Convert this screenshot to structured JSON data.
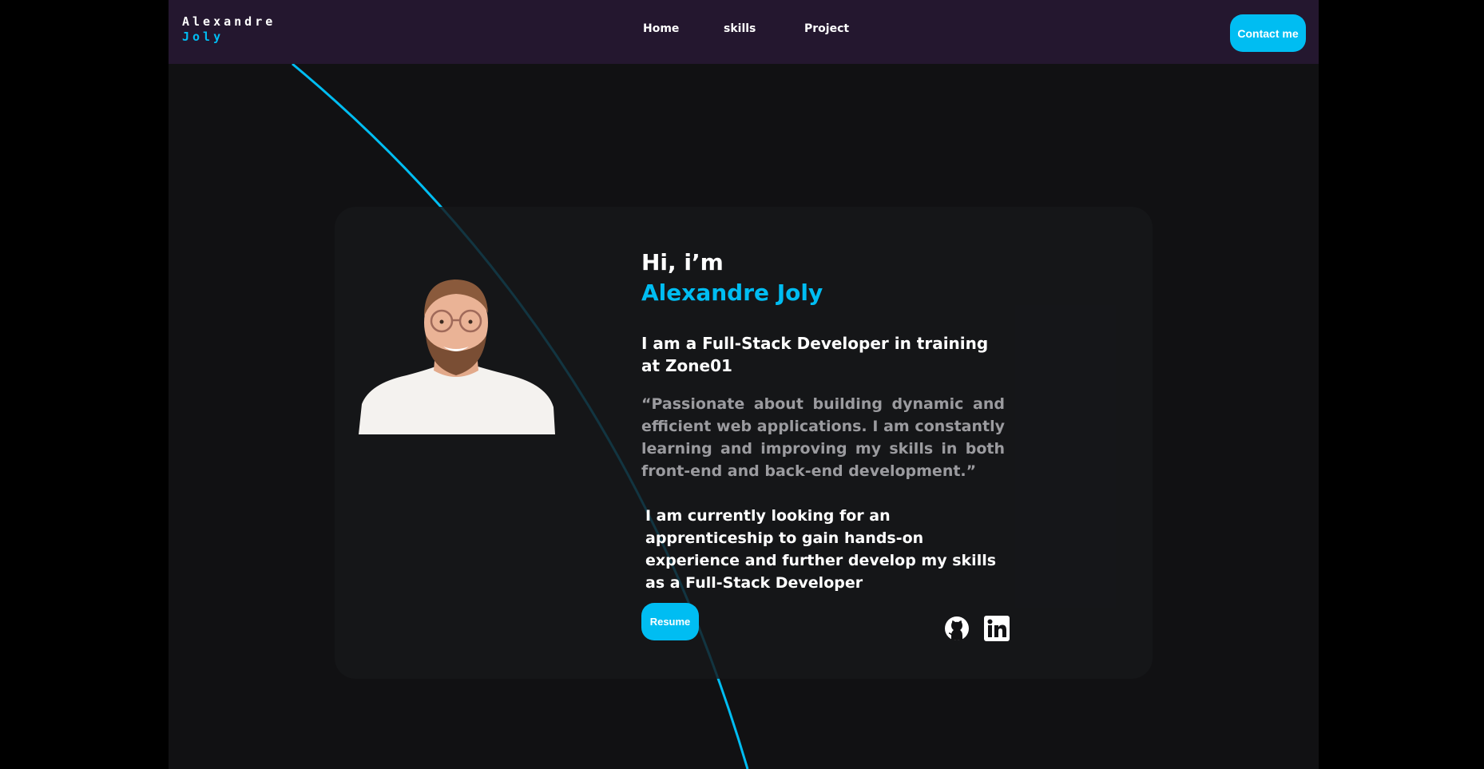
{
  "brand": {
    "first_name": "Alexandre",
    "last_name": "Joly"
  },
  "nav": {
    "items": [
      {
        "label": "Home"
      },
      {
        "label": "skills"
      },
      {
        "label": "Project"
      }
    ],
    "contact_label": "Contact me"
  },
  "hero": {
    "greeting": "Hi, i’m",
    "name": "Alexandre Joly",
    "role": "I am a Full-Stack Developer in training at Zone01",
    "quote": "“Passionate about building dynamic and efficient web applications. I am constantly learning and improving my skills in both front-end and back-end development.”",
    "looking": "I am currently looking for an apprenticeship to gain hands-on experience and further develop my skills as a Full-Stack Developer",
    "resume_label": "Resume"
  },
  "social": {
    "icons": [
      "github-icon",
      "linkedin-icon"
    ]
  },
  "colors": {
    "accent": "#00bdf2",
    "navbar": "#24172f",
    "background": "#111113",
    "card": "#16171a",
    "muted_text": "#9b9b9f"
  }
}
